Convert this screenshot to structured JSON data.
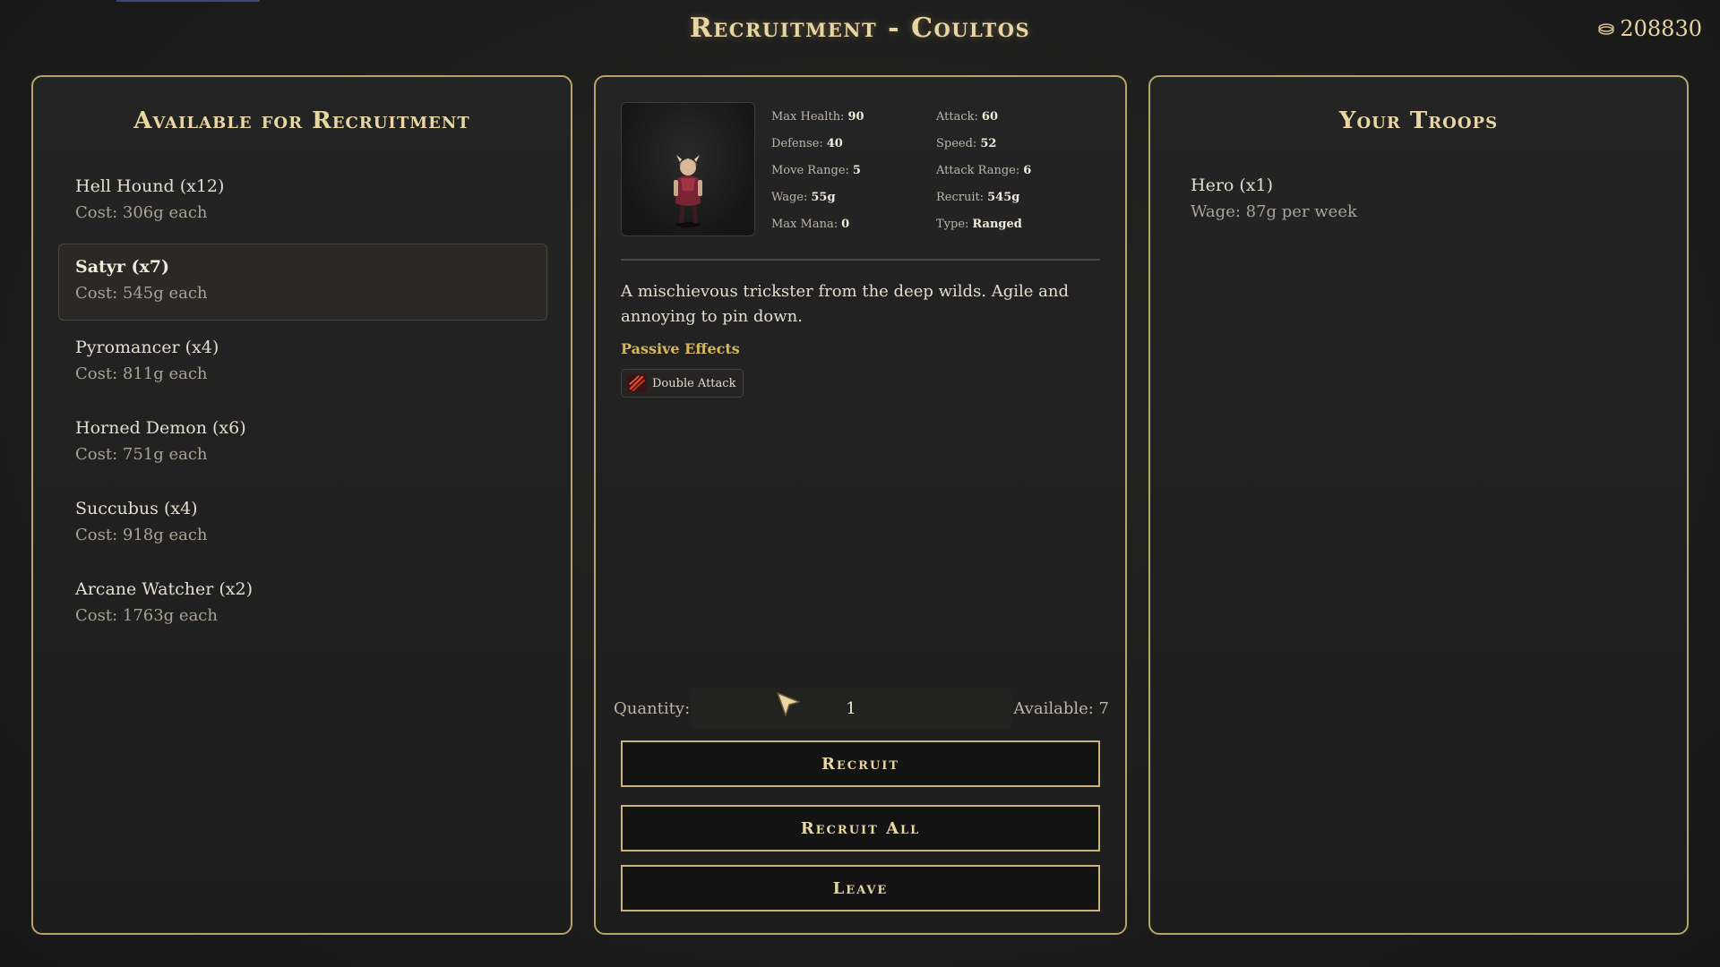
{
  "header": {
    "title": "Recruitment - Coultos",
    "gold": "208830",
    "gold_icon": "coins-icon"
  },
  "available": {
    "heading": "Available for Recruitment",
    "items": [
      {
        "name": "Hell Hound (x12)",
        "cost": "Cost: 306g each"
      },
      {
        "name": "Satyr (x7)",
        "cost": "Cost: 545g each",
        "selected": true
      },
      {
        "name": "Pyromancer (x4)",
        "cost": "Cost: 811g each"
      },
      {
        "name": "Horned Demon (x6)",
        "cost": "Cost: 751g each"
      },
      {
        "name": "Succubus (x4)",
        "cost": "Cost: 918g each"
      },
      {
        "name": "Arcane Watcher (x2)",
        "cost": "Cost: 1763g each"
      }
    ]
  },
  "details": {
    "stats": {
      "max_health_label": "Max Health:",
      "max_health": "90",
      "attack_label": "Attack:",
      "attack": "60",
      "defense_label": "Defense:",
      "defense": "40",
      "speed_label": "Speed:",
      "speed": "52",
      "move_range_label": "Move Range:",
      "move_range": "5",
      "attack_range_label": "Attack Range:",
      "attack_range": "6",
      "wage_label": "Wage:",
      "wage": "55g",
      "recruit_label": "Recruit:",
      "recruit": "545g",
      "max_mana_label": "Max Mana:",
      "max_mana": "0",
      "type_label": "Type:",
      "type": "Ranged"
    },
    "description": "A mischievous trickster from the deep wilds. Agile and annoying to pin down.",
    "passive_title": "Passive Effects",
    "passives": [
      {
        "name": "Double Attack",
        "icon": "claw-slash-icon"
      }
    ],
    "quantity_label": "Quantity:",
    "quantity": "1",
    "available": "Available: 7",
    "buttons": {
      "recruit": "Recruit",
      "recruit_all": "Recruit All",
      "leave": "Leave"
    }
  },
  "troops": {
    "heading": "Your Troops",
    "items": [
      {
        "name": "Hero (x1)",
        "wage": "Wage: 87g per week"
      }
    ]
  },
  "colors": {
    "accent_gold": "#cbb479",
    "heading": "#e8d7a4",
    "passive_title": "#d7b85c",
    "background": "#1e1e1e"
  }
}
